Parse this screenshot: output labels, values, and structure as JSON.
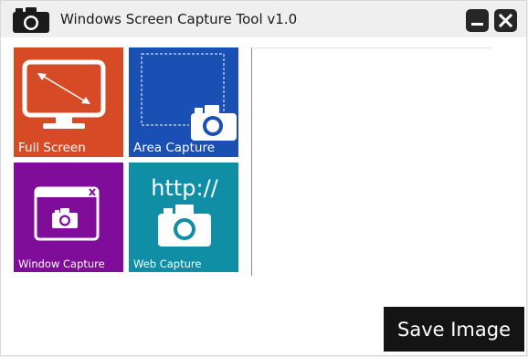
{
  "window": {
    "title": "Windows Screen Capture Tool v1.0",
    "icons": {
      "app": "camera-icon",
      "minimize": "minimize-icon",
      "close": "close-icon"
    }
  },
  "tiles": [
    {
      "id": "full-screen",
      "label": "Full Screen",
      "color": "#d74a26",
      "icon": "monitor-icon"
    },
    {
      "id": "area-capture",
      "label": "Area Capture",
      "color": "#1a4fb3",
      "icon": "area-camera-icon"
    },
    {
      "id": "window-capture",
      "label": "Window Capture",
      "color": "#7f0d9a",
      "icon": "window-camera-icon"
    },
    {
      "id": "web-capture",
      "label": "Web Capture",
      "color": "#0f8ea6",
      "icon": "web-camera-icon",
      "icon_text": "http://"
    }
  ],
  "actions": {
    "save_label": "Save Image"
  }
}
